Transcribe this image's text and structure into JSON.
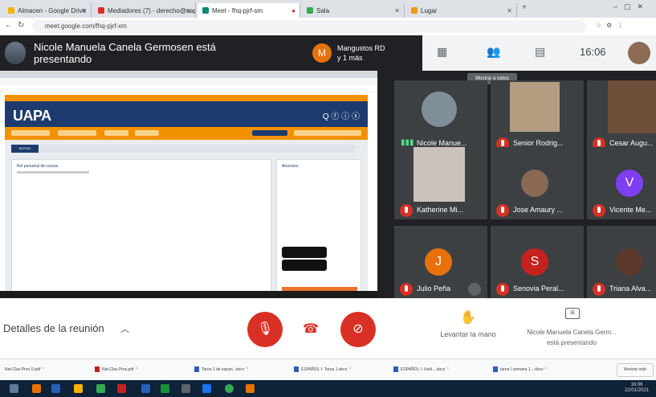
{
  "browser": {
    "tabs": [
      {
        "label": "Almacen - Google Drive"
      },
      {
        "label": "Mediadores (7) - derecho@uapa"
      },
      {
        "label": "Meet - fhq-pjrf-sm"
      },
      {
        "label": "Sala"
      },
      {
        "label": "Lugar"
      }
    ],
    "url": "meet.google.com/fhq-pjrf-xm",
    "accent_active_tab": "#ffffff"
  },
  "meet_header": {
    "presenter_title": "Nicole Manuela Canela Germosen está presentando",
    "group_initial": "M",
    "group_name": "Mangustos RD\ny 1 más",
    "time": "16:06",
    "icons": [
      "layout-icon",
      "people-icon",
      "chat-icon"
    ]
  },
  "shared_screen": {
    "site_logo": "UAPA",
    "social": "Q ⓕ ⓘ ⓢ",
    "button": "BOTON",
    "left_panel_title": "Rol personal de cursos",
    "right_panel_title": "Anuncios",
    "brand_colors": {
      "orange": "#f39200",
      "navy": "#1d3b6f"
    }
  },
  "tooltip": "Mostrar a todos",
  "participants": [
    {
      "name": "Nicole Manue...",
      "kind": "avatar-photo",
      "mic": "speaking"
    },
    {
      "name": "Senior Rodrig...",
      "kind": "video",
      "mic": "muted"
    },
    {
      "name": "Cesar Augu...",
      "kind": "video",
      "mic": "muted"
    },
    {
      "name": "Katherine Mi...",
      "kind": "video",
      "mic": "muted"
    },
    {
      "name": "Jose Amaury ...",
      "kind": "avatar-photo",
      "mic": "muted"
    },
    {
      "name": "Vicente Me...",
      "kind": "initial",
      "initial": "V",
      "color": "#7e3ff2",
      "mic": "muted"
    },
    {
      "name": "Julio Peña",
      "kind": "initial",
      "initial": "J",
      "color": "#e8710a",
      "mic": "muted"
    },
    {
      "name": "Senovia Peral...",
      "kind": "initial",
      "initial": "S",
      "color": "#c5221f",
      "mic": "muted"
    },
    {
      "name": "Triana Alva...",
      "kind": "avatar-photo",
      "mic": "muted"
    }
  ],
  "controls": {
    "meeting_details": "Detalles de la reunión",
    "raise_hand": "Levantar la mano",
    "presenting": "Nicole Manuela Canela Germ...\nestá presentando",
    "end_call_color": "#d93025"
  },
  "downloads": [
    "Nat-Clas Pres U.pdf",
    "Nat-Clas Pres.pdf",
    "Tarea 1 de espan...docx",
    "ESPAÑOL I- Tarea 1.docx",
    "ESPAÑOL I- Unid....docx",
    "tarea I semana 1....docx"
  ],
  "downloads_show_all": "Mostrar todo",
  "taskbar": {
    "time": "16:06",
    "date": "22/01/2021"
  }
}
